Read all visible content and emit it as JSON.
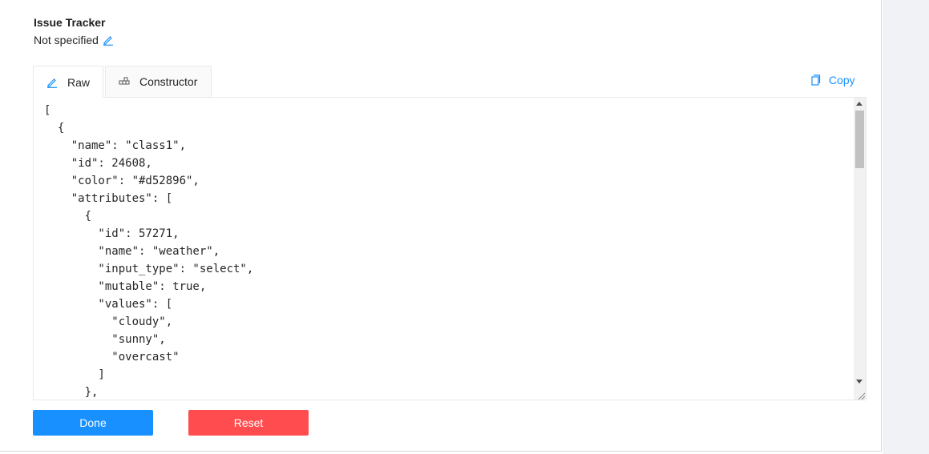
{
  "issue_tracker": {
    "title": "Issue Tracker",
    "value": "Not specified"
  },
  "tabs": [
    {
      "label": "Raw",
      "icon": "pencil-icon",
      "active": true
    },
    {
      "label": "Constructor",
      "icon": "blocks-icon",
      "active": false
    }
  ],
  "copy_label": "Copy",
  "editor": {
    "lines": [
      "[",
      "  {",
      "    \"name\": \"class1\",",
      "    \"id\": 24608,",
      "    \"color\": \"#d52896\",",
      "    \"attributes\": [",
      "      {",
      "        \"id\": 57271,",
      "        \"name\": \"weather\",",
      "        \"input_type\": \"select\",",
      "        \"mutable\": true,",
      "        \"values\": [",
      "          \"cloudy\",",
      "          \"sunny\",",
      "          \"overcast\"",
      "        ]",
      "      },"
    ]
  },
  "buttons": {
    "done_label": "Done",
    "reset_label": "Reset"
  },
  "colors": {
    "primary": "#1890ff",
    "danger": "#ff4d4f"
  }
}
